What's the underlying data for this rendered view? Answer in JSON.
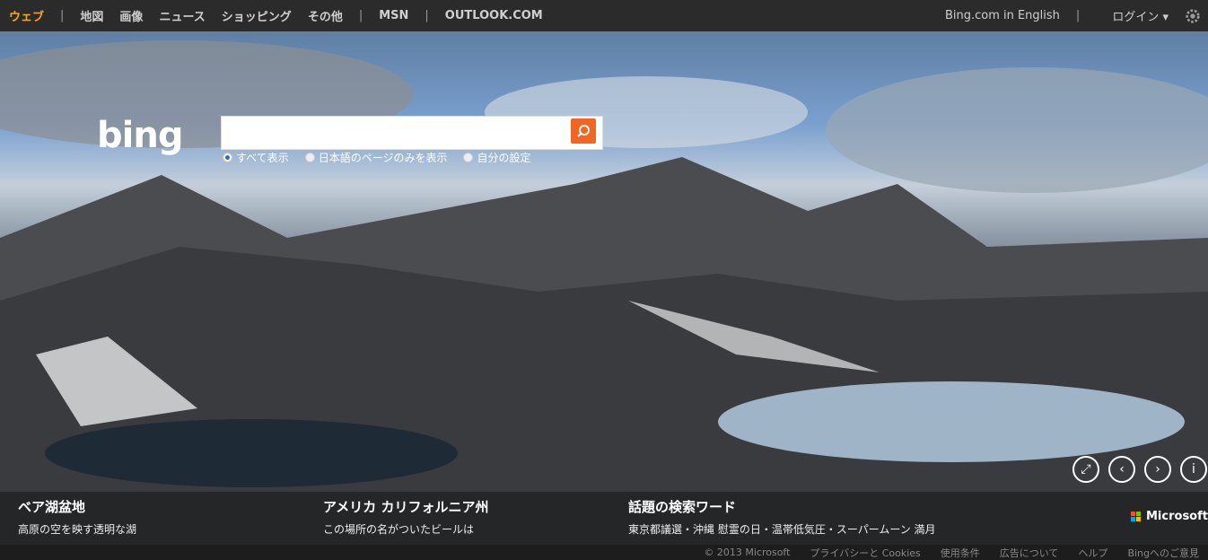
{
  "topbar": {
    "nav": [
      "ウェブ",
      "地図",
      "画像",
      "ニュース",
      "ショッピング",
      "その他"
    ],
    "extra": [
      "MSN",
      "OUTLOOK.COM"
    ],
    "right": [
      "Bing.com in English",
      "ログイン"
    ]
  },
  "logo": {
    "text": "bing"
  },
  "search": {
    "radios": [
      "すべて表示",
      "日本語のページのみを表示",
      "自分の設定"
    ]
  },
  "controls": {
    "icons": [
      "expand-icon",
      "prev-icon",
      "next-icon",
      "info-icon"
    ]
  },
  "info_items": [
    {
      "title": "ベア湖盆地",
      "subtitle": "高原の空を映す透明な湖"
    },
    {
      "title": "アメリカ カリフォルニア州",
      "subtitle": "この場所の名がついたビールは"
    },
    {
      "title": "話題の検索ワード",
      "subtitle": "東京都議選・沖縄 慰霊の日・温帯低気圧・スーパームーン 満月"
    }
  ],
  "brand": {
    "microsoft": "Microsoft"
  },
  "footer": [
    "© 2013 Microsoft",
    "プライバシーと Cookies",
    "使用条件",
    "広告について",
    "ヘルプ",
    "Bingへのご意見"
  ]
}
